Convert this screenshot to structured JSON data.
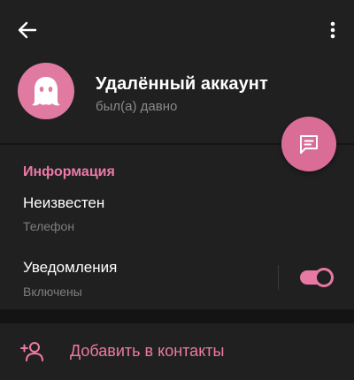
{
  "profile": {
    "name": "Удалённый аккаунт",
    "status": "был(а) давно"
  },
  "info": {
    "section_title": "Информация",
    "phone_value": "Неизвестен",
    "phone_label": "Телефон",
    "notifications_value": "Уведомления",
    "notifications_label": "Включены",
    "notifications_enabled": true
  },
  "actions": {
    "add_contact_label": "Добавить в контакты"
  },
  "icons": {
    "back": "arrow-left-icon",
    "menu": "more-vertical-icon",
    "avatar": "ghost-icon",
    "fab": "message-icon",
    "add_contact": "add-person-icon"
  },
  "colors": {
    "accent": "#ec7aa6",
    "avatar_bg": "#e07aa0",
    "background": "#202020"
  }
}
